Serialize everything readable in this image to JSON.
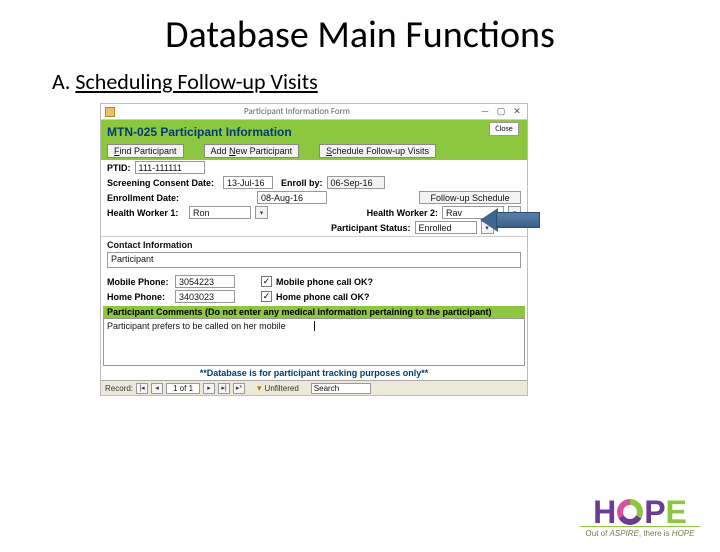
{
  "slide": {
    "title": "Database Main Functions"
  },
  "section": {
    "prefix": "A. ",
    "title": "Scheduling Follow-up Visits"
  },
  "win": {
    "title": "Participant Information Form",
    "close": "Close",
    "header_title": "MTN-025 Participant Information"
  },
  "buttons": {
    "find": "Find Participant",
    "add": "Add New Participant",
    "schedule": "Schedule Follow-up Visits"
  },
  "labels": {
    "ptid": "PTID:",
    "screening": "Screening Consent Date:",
    "enroll_by": "Enroll by:",
    "enroll_date": "Enrollment Date:",
    "followup_sched": "Follow-up Schedule",
    "hw1": "Health Worker 1:",
    "hw2": "Health Worker 2:",
    "pstatus": "Participant Status:",
    "contact_info": "Contact Information",
    "mobile": "Mobile Phone:",
    "mobile_ok": "Mobile phone call OK?",
    "home": "Home Phone:",
    "home_ok": "Home phone call OK?",
    "comments_hdr": "Participant Comments (Do not enter any medical information pertaining to the participant)"
  },
  "values": {
    "ptid": "111-111111",
    "screening_date": "13-Jul-16",
    "enroll_by": "06-Sep-16",
    "enroll_date": "08-Aug-16",
    "hw1": "Ron",
    "hw2": "Rav",
    "pstatus": "Enrolled",
    "participant_name": "Participant",
    "mobile": "3054223",
    "mobile_ok": true,
    "home": "3403023",
    "home_ok": true,
    "comments": "Participant prefers to be called on her mobile"
  },
  "footer": {
    "note": "**Database is for participant tracking purposes only**"
  },
  "recordnav": {
    "label": "Record:",
    "pos": "1 of 1",
    "filter": "Unfiltered",
    "search_placeholder": "Search"
  },
  "logo": {
    "h": "H",
    "p": "P",
    "e": "E",
    "tagline_pre": "Out of ",
    "tagline_em1": "ASPIRE",
    "tagline_mid": ", there is ",
    "tagline_em2": "HOPE"
  }
}
